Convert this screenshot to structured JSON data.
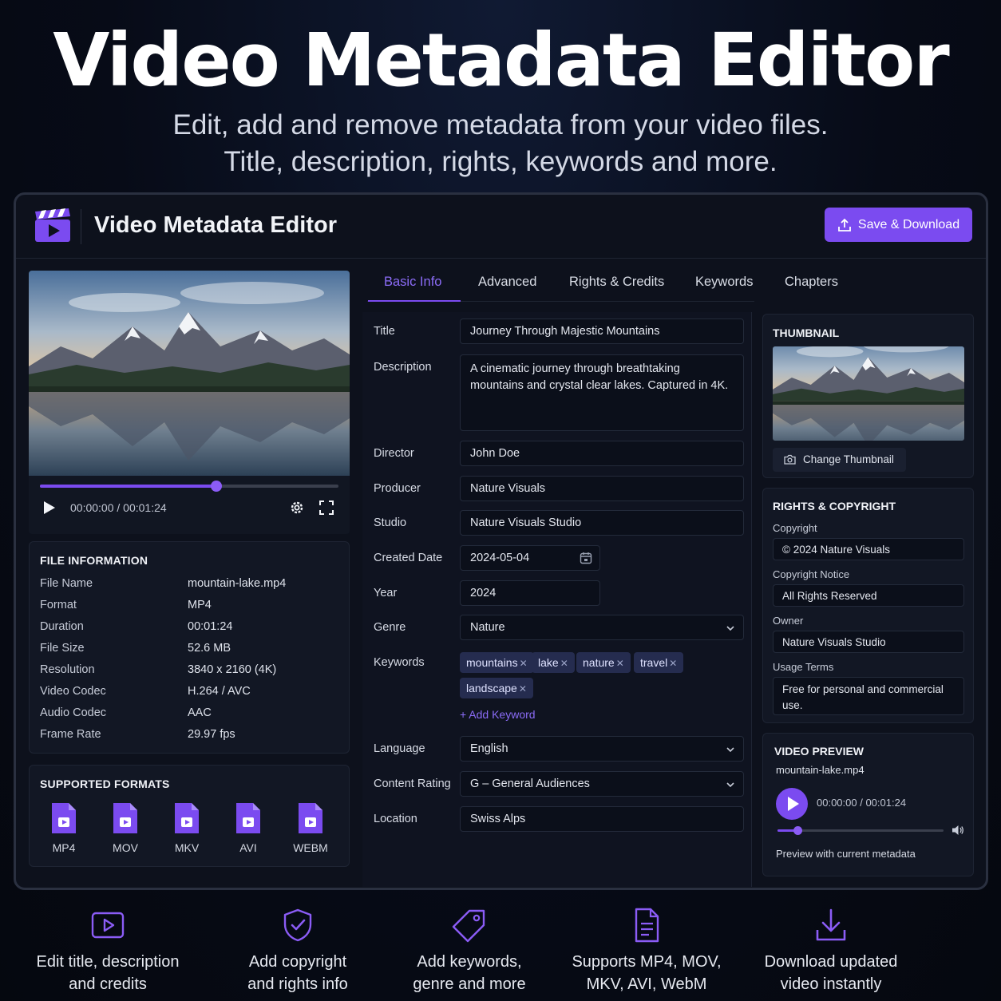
{
  "hero": {
    "title": "Video Metadata Editor",
    "subtitle_line1": "Edit, add and remove metadata from your video files.",
    "subtitle_line2": "Title, description, rights, keywords and more."
  },
  "app": {
    "title": "Video Metadata Editor",
    "save_label": "Save & Download",
    "accent_color": "#7b4bf0"
  },
  "player": {
    "time": "00:00:00 / 00:01:24",
    "progress": 0.59
  },
  "file_info": {
    "heading": "FILE INFORMATION",
    "rows": [
      {
        "key": "File Name",
        "value": "mountain-lake.mp4"
      },
      {
        "key": "Format",
        "value": "MP4"
      },
      {
        "key": "Duration",
        "value": "00:01:24"
      },
      {
        "key": "File Size",
        "value": "52.6 MB"
      },
      {
        "key": "Resolution",
        "value": "3840 x 2160 (4K)"
      },
      {
        "key": "Video Codec",
        "value": "H.264 / AVC"
      },
      {
        "key": "Audio Codec",
        "value": "AAC"
      },
      {
        "key": "Frame Rate",
        "value": "29.97 fps"
      }
    ]
  },
  "formats": {
    "heading": "SUPPORTED FORMATS",
    "items": [
      "MP4",
      "MOV",
      "MKV",
      "AVI",
      "WEBM"
    ]
  },
  "tabs": [
    "Basic Info",
    "Advanced",
    "Rights & Credits",
    "Keywords",
    "Chapters"
  ],
  "form": {
    "title_label": "Title",
    "title_value": "Journey Through Majestic Mountains",
    "description_label": "Description",
    "description_value": "A cinematic journey through breathtaking mountains and crystal clear lakes. Captured in 4K.",
    "director_label": "Director",
    "director_value": "John Doe",
    "producer_label": "Producer",
    "producer_value": "Nature Visuals",
    "studio_label": "Studio",
    "studio_value": "Nature Visuals Studio",
    "created_label": "Created Date",
    "created_value": "2024-05-04",
    "year_label": "Year",
    "year_value": "2024",
    "genre_label": "Genre",
    "genre_value": "Nature",
    "keywords_label": "Keywords",
    "keywords": [
      "mountains",
      "lake",
      "nature",
      "travel",
      "landscape"
    ],
    "add_keyword": "+ Add Keyword",
    "language_label": "Language",
    "language_value": "English",
    "rating_label": "Content Rating",
    "rating_value": "G – General Audiences",
    "location_label": "Location",
    "location_value": "Swiss Alps"
  },
  "thumbnail": {
    "heading": "THUMBNAIL",
    "change_label": "Change Thumbnail"
  },
  "rights": {
    "heading": "RIGHTS & COPYRIGHT",
    "copyright_label": "Copyright",
    "copyright_value": "© 2024 Nature Visuals",
    "notice_label": "Copyright Notice",
    "notice_value": "All Rights Reserved",
    "owner_label": "Owner",
    "owner_value": "Nature Visuals Studio",
    "terms_label": "Usage Terms",
    "terms_value": "Free for personal and commercial use."
  },
  "preview": {
    "heading": "VIDEO PREVIEW",
    "filename": "mountain-lake.mp4",
    "time": "00:00:00 / 00:01:24",
    "progress": 0.12,
    "caption": "Preview with current metadata"
  },
  "features": [
    {
      "line1": "Edit title, description",
      "line2": "and credits",
      "icon": "play-icon"
    },
    {
      "line1": "Add copyright",
      "line2": "and rights info",
      "icon": "shield-check-icon"
    },
    {
      "line1": "Add keywords,",
      "line2": "genre and more",
      "icon": "tag-icon"
    },
    {
      "line1": "Supports MP4, MOV,",
      "line2": "MKV, AVI, WebM",
      "icon": "document-icon"
    },
    {
      "line1": "Download updated",
      "line2": "video instantly",
      "icon": "download-icon"
    }
  ]
}
